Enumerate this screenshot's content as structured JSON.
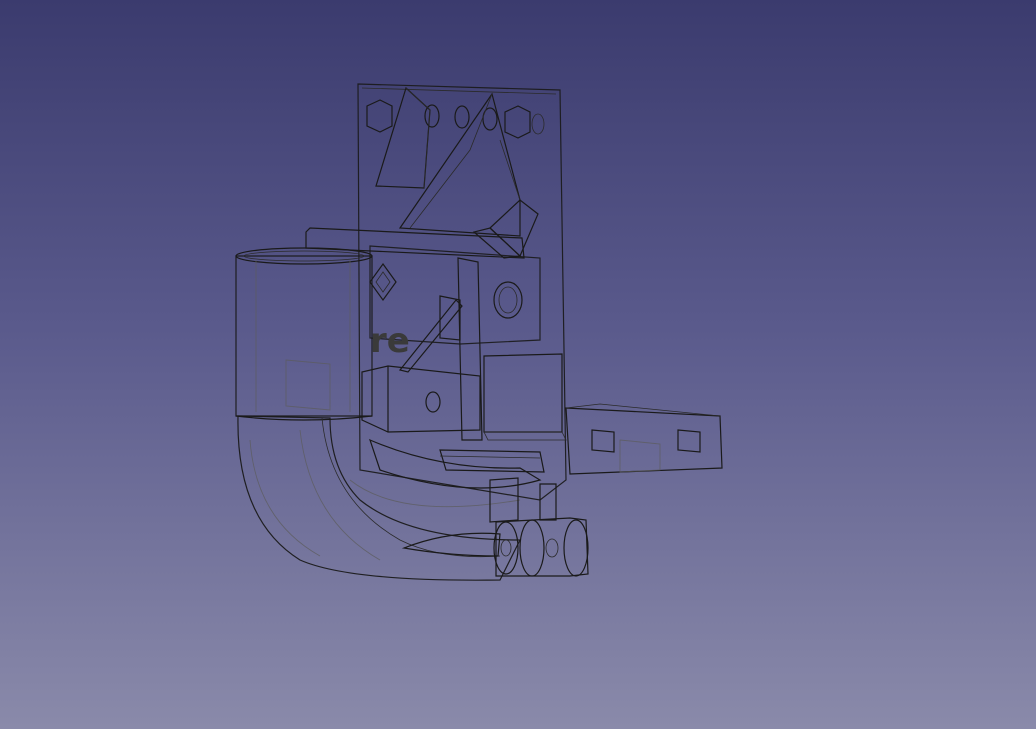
{
  "viewport": {
    "background_top": "#3b3b6e",
    "background_bottom": "#8a8aaa"
  },
  "model": {
    "fill_light": "#d2d2d2",
    "fill_mid": "#a8a8a8",
    "fill_dark": "#7a7a7a",
    "edge_color": "#1a1a1a"
  },
  "engraving": {
    "text": "re"
  }
}
